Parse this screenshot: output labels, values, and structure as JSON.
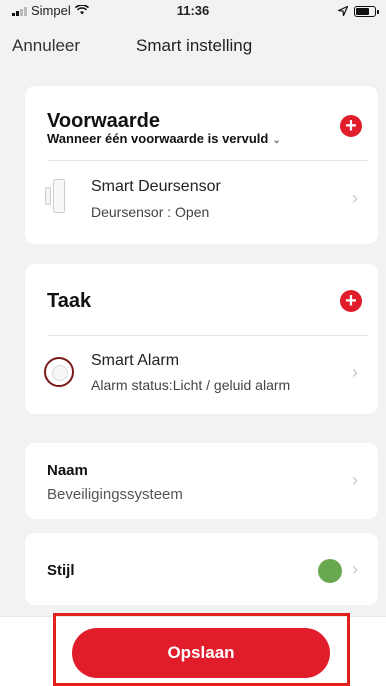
{
  "status_bar": {
    "carrier": "Simpel",
    "time": "11:36",
    "battery_level": 0.7
  },
  "nav": {
    "cancel_label": "Annuleer",
    "title": "Smart instelling"
  },
  "condition": {
    "heading": "Voorwaarde",
    "subtitle": "Wanneer één voorwaarde is vervuld",
    "device_name": "Smart Deursensor",
    "device_state": "Deursensor : Open"
  },
  "task": {
    "heading": "Taak",
    "device_name": "Smart Alarm",
    "device_state": "Alarm status:Licht / geluid alarm"
  },
  "name_field": {
    "label": "Naam",
    "value": "Beveiligingssysteem"
  },
  "style_field": {
    "label": "Stijl",
    "color": "#6aa84f"
  },
  "save_label": "Opslaan",
  "colors": {
    "accent": "#e11d2c",
    "highlight": "#e0201b"
  }
}
